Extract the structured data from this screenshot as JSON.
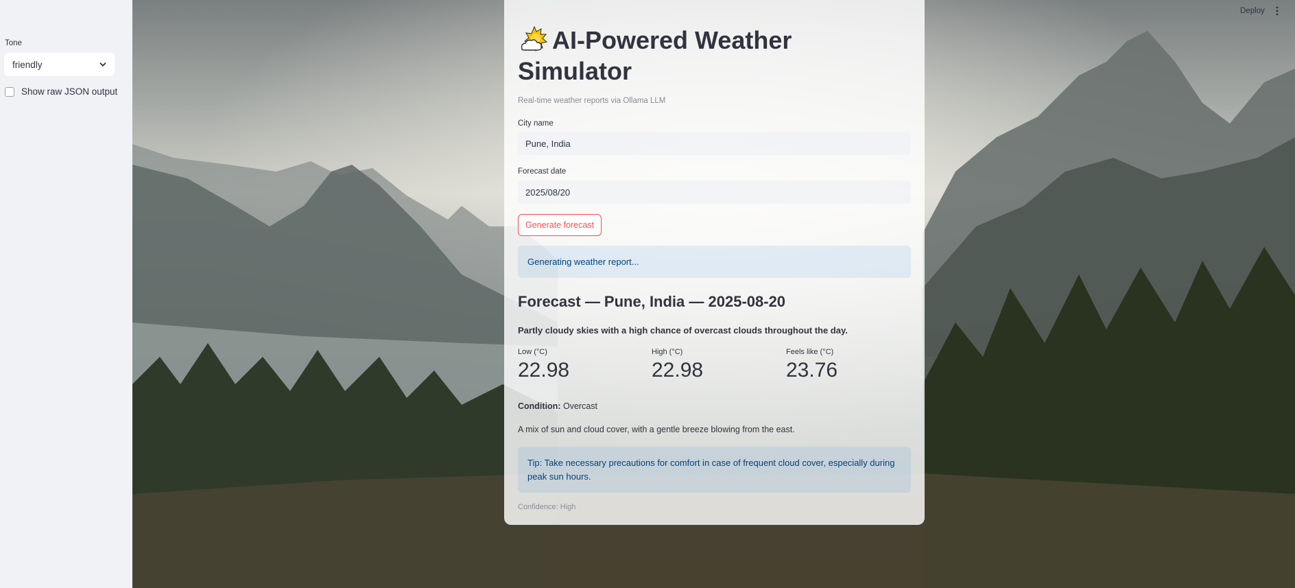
{
  "sidebar": {
    "tone_label": "Tone",
    "tone_value": "friendly",
    "raw_json_label": "Show raw JSON output",
    "raw_json_checked": false
  },
  "header": {
    "deploy_label": "Deploy",
    "menu_icon": "vertical-dots-icon"
  },
  "main": {
    "title_icon": "sun-behind-cloud-icon",
    "title": "AI-Powered Weather Simulator",
    "caption": "Real-time weather reports via Ollama LLM",
    "city_label": "City name",
    "city_value": "Pune, India",
    "date_label": "Forecast date",
    "date_value": "2025/08/20",
    "generate_button": "Generate forecast",
    "status_message": "Generating weather report...",
    "forecast_title": "Forecast — Pune, India — 2025-08-20",
    "summary": "Partly cloudy skies with a high chance of overcast clouds throughout the day.",
    "metrics": [
      {
        "label": "Low (°C)",
        "value": "22.98"
      },
      {
        "label": "High (°C)",
        "value": "22.98"
      },
      {
        "label": "Feels like (°C)",
        "value": "23.76"
      }
    ],
    "condition_label": "Condition:",
    "condition_value": "Overcast",
    "description": "A mix of sun and cloud cover, with a gentle breeze blowing from the east.",
    "tip": "Tip: Take necessary precautions for comfort in case of frequent cloud cover, especially during peak sun hours.",
    "confidence": "Confidence: High"
  },
  "colors": {
    "accent": "#ff4b4b",
    "info_text": "#004280",
    "sidebar_bg": "#f0f2f6"
  }
}
